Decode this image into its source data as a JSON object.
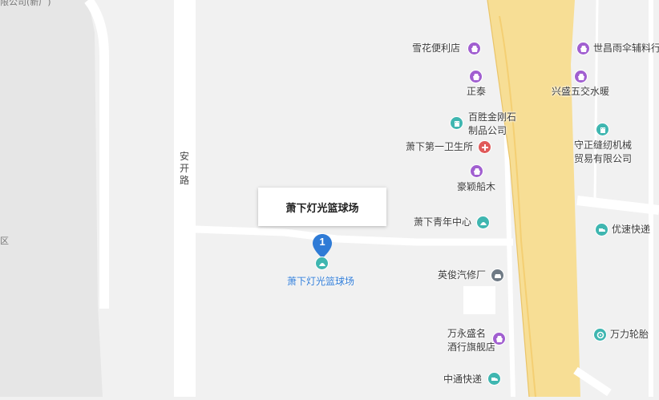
{
  "map": {
    "selected_place": {
      "pin_number": "1",
      "callout_title": "萧下灯光篮球场",
      "name": "萧下灯光篮球场"
    },
    "roads": {
      "vertical_road_name": "安\n开\n路"
    },
    "edge_labels": {
      "top_left": "限公司(新厂)",
      "left": "区"
    },
    "pois": [
      {
        "id": "xuehua",
        "label": "雪花便利店",
        "icon": "shop-icon",
        "color": "purple"
      },
      {
        "id": "zhengtai",
        "label": "正泰",
        "icon": "shop-icon",
        "color": "purple"
      },
      {
        "id": "baisheng",
        "label": "百胜金刚石\n制品公司",
        "icon": "building-icon",
        "color": "teal"
      },
      {
        "id": "clinic",
        "label": "萧下第一卫生所",
        "icon": "hospital-icon",
        "color": "red"
      },
      {
        "id": "haoying",
        "label": "豪颖船木",
        "icon": "shop-icon",
        "color": "purple"
      },
      {
        "id": "youth",
        "label": "萧下青年中心",
        "icon": "venue-icon",
        "color": "teal"
      },
      {
        "id": "yingjun",
        "label": "英俊汽修厂",
        "icon": "car-icon",
        "color": "gray"
      },
      {
        "id": "wanyong",
        "label": "万永盛名\n酒行旗舰店",
        "icon": "shop-icon",
        "color": "purple"
      },
      {
        "id": "zhongtong",
        "label": "中通快递",
        "icon": "delivery-icon",
        "color": "teal"
      },
      {
        "id": "shichang",
        "label": "世昌雨伞辅料行",
        "icon": "shop-icon",
        "color": "purple"
      },
      {
        "id": "xingsheng",
        "label": "兴盛五交水暖",
        "icon": "shop-icon",
        "color": "purple"
      },
      {
        "id": "shouzheng",
        "label": "守正缝纫机械\n贸易有限公司",
        "icon": "building-icon",
        "color": "teal"
      },
      {
        "id": "yousu",
        "label": "优速快递",
        "icon": "delivery-icon",
        "color": "teal"
      },
      {
        "id": "wanli",
        "label": "万力轮胎",
        "icon": "tire-icon",
        "color": "teal"
      }
    ]
  }
}
